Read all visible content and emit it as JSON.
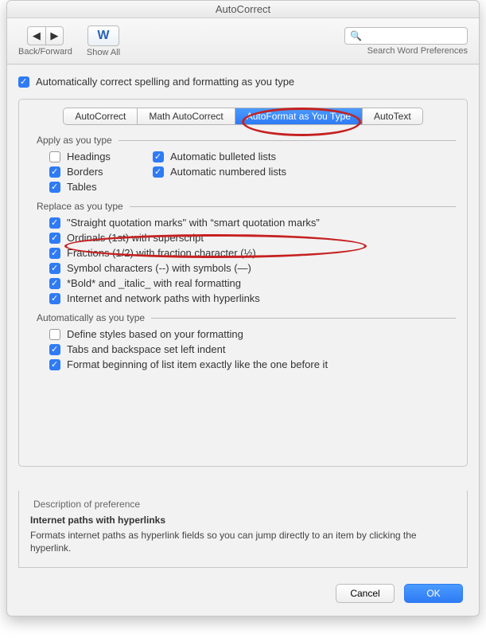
{
  "window": {
    "title": "AutoCorrect"
  },
  "toolbar": {
    "back_forward_label": "Back/Forward",
    "show_all_label": "Show All",
    "show_all_icon_text": "W",
    "search_placeholder": "",
    "search_label": "Search Word Preferences"
  },
  "top_checkbox": {
    "label": "Automatically correct spelling and formatting as you type",
    "checked": true
  },
  "tabs": [
    {
      "label": "AutoCorrect",
      "active": false
    },
    {
      "label": "Math AutoCorrect",
      "active": false
    },
    {
      "label": "AutoFormat as You Type",
      "active": true
    },
    {
      "label": "AutoText",
      "active": false
    }
  ],
  "sections": {
    "apply": {
      "title": "Apply as you type",
      "col": [
        {
          "label": "Headings",
          "checked": false
        },
        {
          "label": "Borders",
          "checked": true
        },
        {
          "label": "Tables",
          "checked": true
        },
        {
          "label": "Automatic bulleted lists",
          "checked": true
        },
        {
          "label": "Automatic numbered lists",
          "checked": true
        }
      ]
    },
    "replace": {
      "title": "Replace as you type",
      "items": [
        {
          "label": "\"Straight quotation marks\" with “smart quotation marks”",
          "checked": true
        },
        {
          "label": "Ordinals (1st) with superscript",
          "checked": true
        },
        {
          "label": "Fractions (1/2) with fraction character (½)",
          "checked": true
        },
        {
          "label": "Symbol characters (--) with symbols (—)",
          "checked": true
        },
        {
          "label": "*Bold* and _italic_ with real formatting",
          "checked": true
        },
        {
          "label": "Internet and network paths with hyperlinks",
          "checked": true
        }
      ]
    },
    "auto": {
      "title": "Automatically as you type",
      "items": [
        {
          "label": "Define styles based on your formatting",
          "checked": false
        },
        {
          "label": "Tabs and backspace set left indent",
          "checked": true
        },
        {
          "label": "Format beginning of list item exactly like the one before it",
          "checked": true
        }
      ]
    }
  },
  "description": {
    "header": "Description of preference",
    "title": "Internet paths with hyperlinks",
    "text": "Formats internet paths as hyperlink fields so you can jump directly to an item by clicking the hyperlink."
  },
  "buttons": {
    "cancel": "Cancel",
    "ok": "OK"
  }
}
